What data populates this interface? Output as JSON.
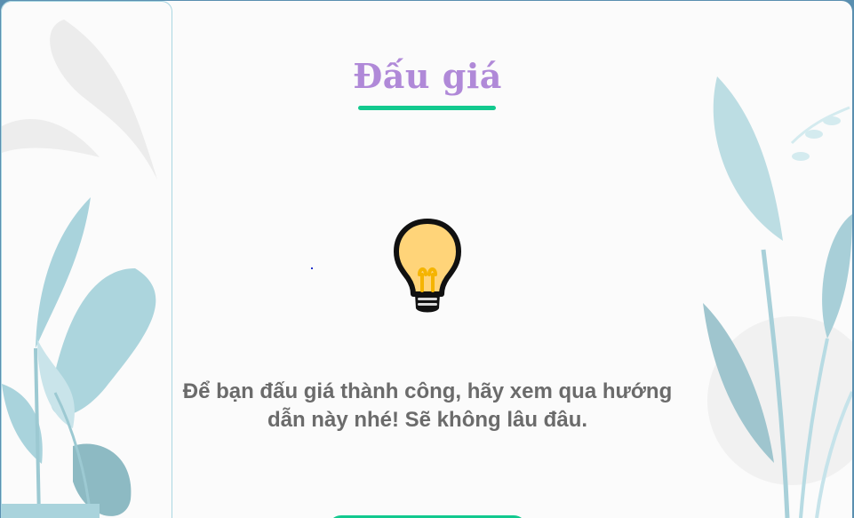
{
  "page": {
    "title": "Đấu giá",
    "message": "Để bạn đấu giá thành công, hãy xem qua hướng dẫn này nhé! Sẽ không lâu đâu."
  },
  "icons": {
    "illustration": "lightbulb-icon",
    "decoration": "plant-leaves"
  },
  "colors": {
    "title": "#b089d8",
    "accent": "#12c98e",
    "text": "#6b6b6b",
    "leaf_light": "#acd5dd",
    "leaf_dark": "#8dbac3",
    "bulb_fill": "#ffd479",
    "bulb_filament": "#f5b400",
    "background": "#fbfbfb"
  }
}
